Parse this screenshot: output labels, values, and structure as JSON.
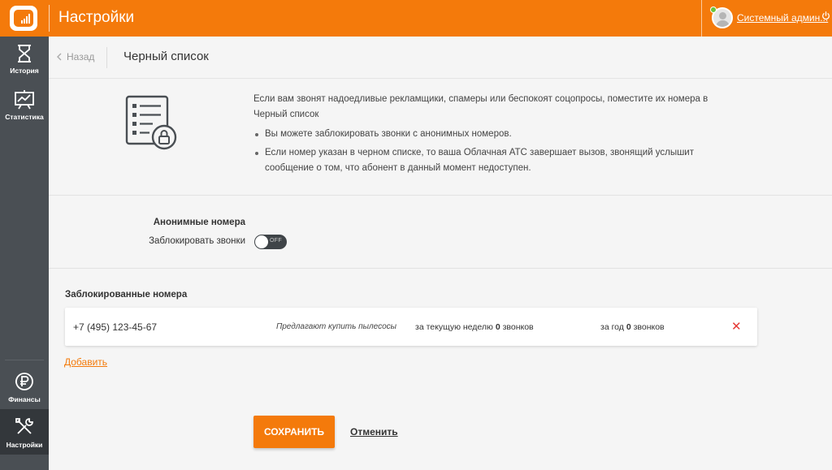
{
  "header": {
    "app_title": "Настройки",
    "user_name": "Системный админ...",
    "icons": {
      "logo": "chart-bars-logo",
      "power": "power-icon",
      "avatar": "user-avatar"
    },
    "colors": {
      "brand": "#f47a0b",
      "status_online": "#6ac43a"
    }
  },
  "sidebar": {
    "items": [
      {
        "label": "История",
        "icon": "hourglass-icon"
      },
      {
        "label": "Статистика",
        "icon": "stats-board-icon"
      },
      {
        "label": "Финансы",
        "icon": "ruble-coins-icon"
      },
      {
        "label": "Настройки",
        "icon": "tools-icon",
        "active": true
      }
    ],
    "colors": {
      "background": "#4a4f54",
      "active": "#33373b"
    }
  },
  "subheader": {
    "back_label": "Назад",
    "title": "Черный список"
  },
  "info": {
    "intro": "Если вам звонят надоедливые рекламщики, спамеры или беспокоят соцопросы, поместите их номера в Черный список",
    "bullets": [
      "Вы можете заблокировать звонки с анонимных номеров.",
      "Если номер указан в черном списке, то ваша Облачная АТС завершает вызов, звонящий услышит сообщение о том, что абонент в данный момент недоступен."
    ],
    "icon": "blacklist-lock-icon"
  },
  "anonymous": {
    "section_title": "Анонимные номера",
    "block_label": "Заблокировать звонки",
    "toggle_state": "OFF"
  },
  "blocked": {
    "section_title": "Заблокированные номера",
    "rows": [
      {
        "phone": "+7 (495) 123-45-67",
        "description": "Предлагают купить пылесосы",
        "week_prefix": "за текущую неделю",
        "week_count": "0",
        "week_suffix": "звонков",
        "year_prefix": "за год",
        "year_count": "0",
        "year_suffix": "звонков",
        "delete_glyph": "✕"
      }
    ],
    "add_label": "Добавить"
  },
  "actions": {
    "save_label": "СОХРАНИТЬ",
    "cancel_label": "Отменить"
  }
}
